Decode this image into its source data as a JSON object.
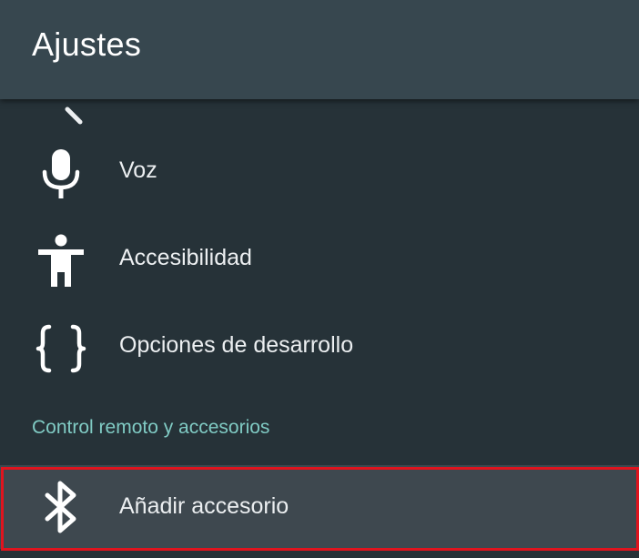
{
  "app_bar": {
    "title": "Ajustes"
  },
  "settings_list": {
    "items": [
      {
        "label": "Voz",
        "icon": "microphone-icon"
      },
      {
        "label": "Accesibilidad",
        "icon": "accessibility-icon"
      },
      {
        "label": "Opciones de desarrollo",
        "icon": "code-braces-icon"
      }
    ],
    "section_header": "Control remoto y accesorios",
    "accessory_item": {
      "label": "Añadir accesorio",
      "icon": "bluetooth-icon"
    }
  },
  "colors": {
    "background": "#263238",
    "app_bar": "#37474f",
    "section_header": "#80cbc4",
    "focused_row": "#3e484f",
    "highlight_outline": "#e0141e",
    "text": "#eceff1"
  }
}
